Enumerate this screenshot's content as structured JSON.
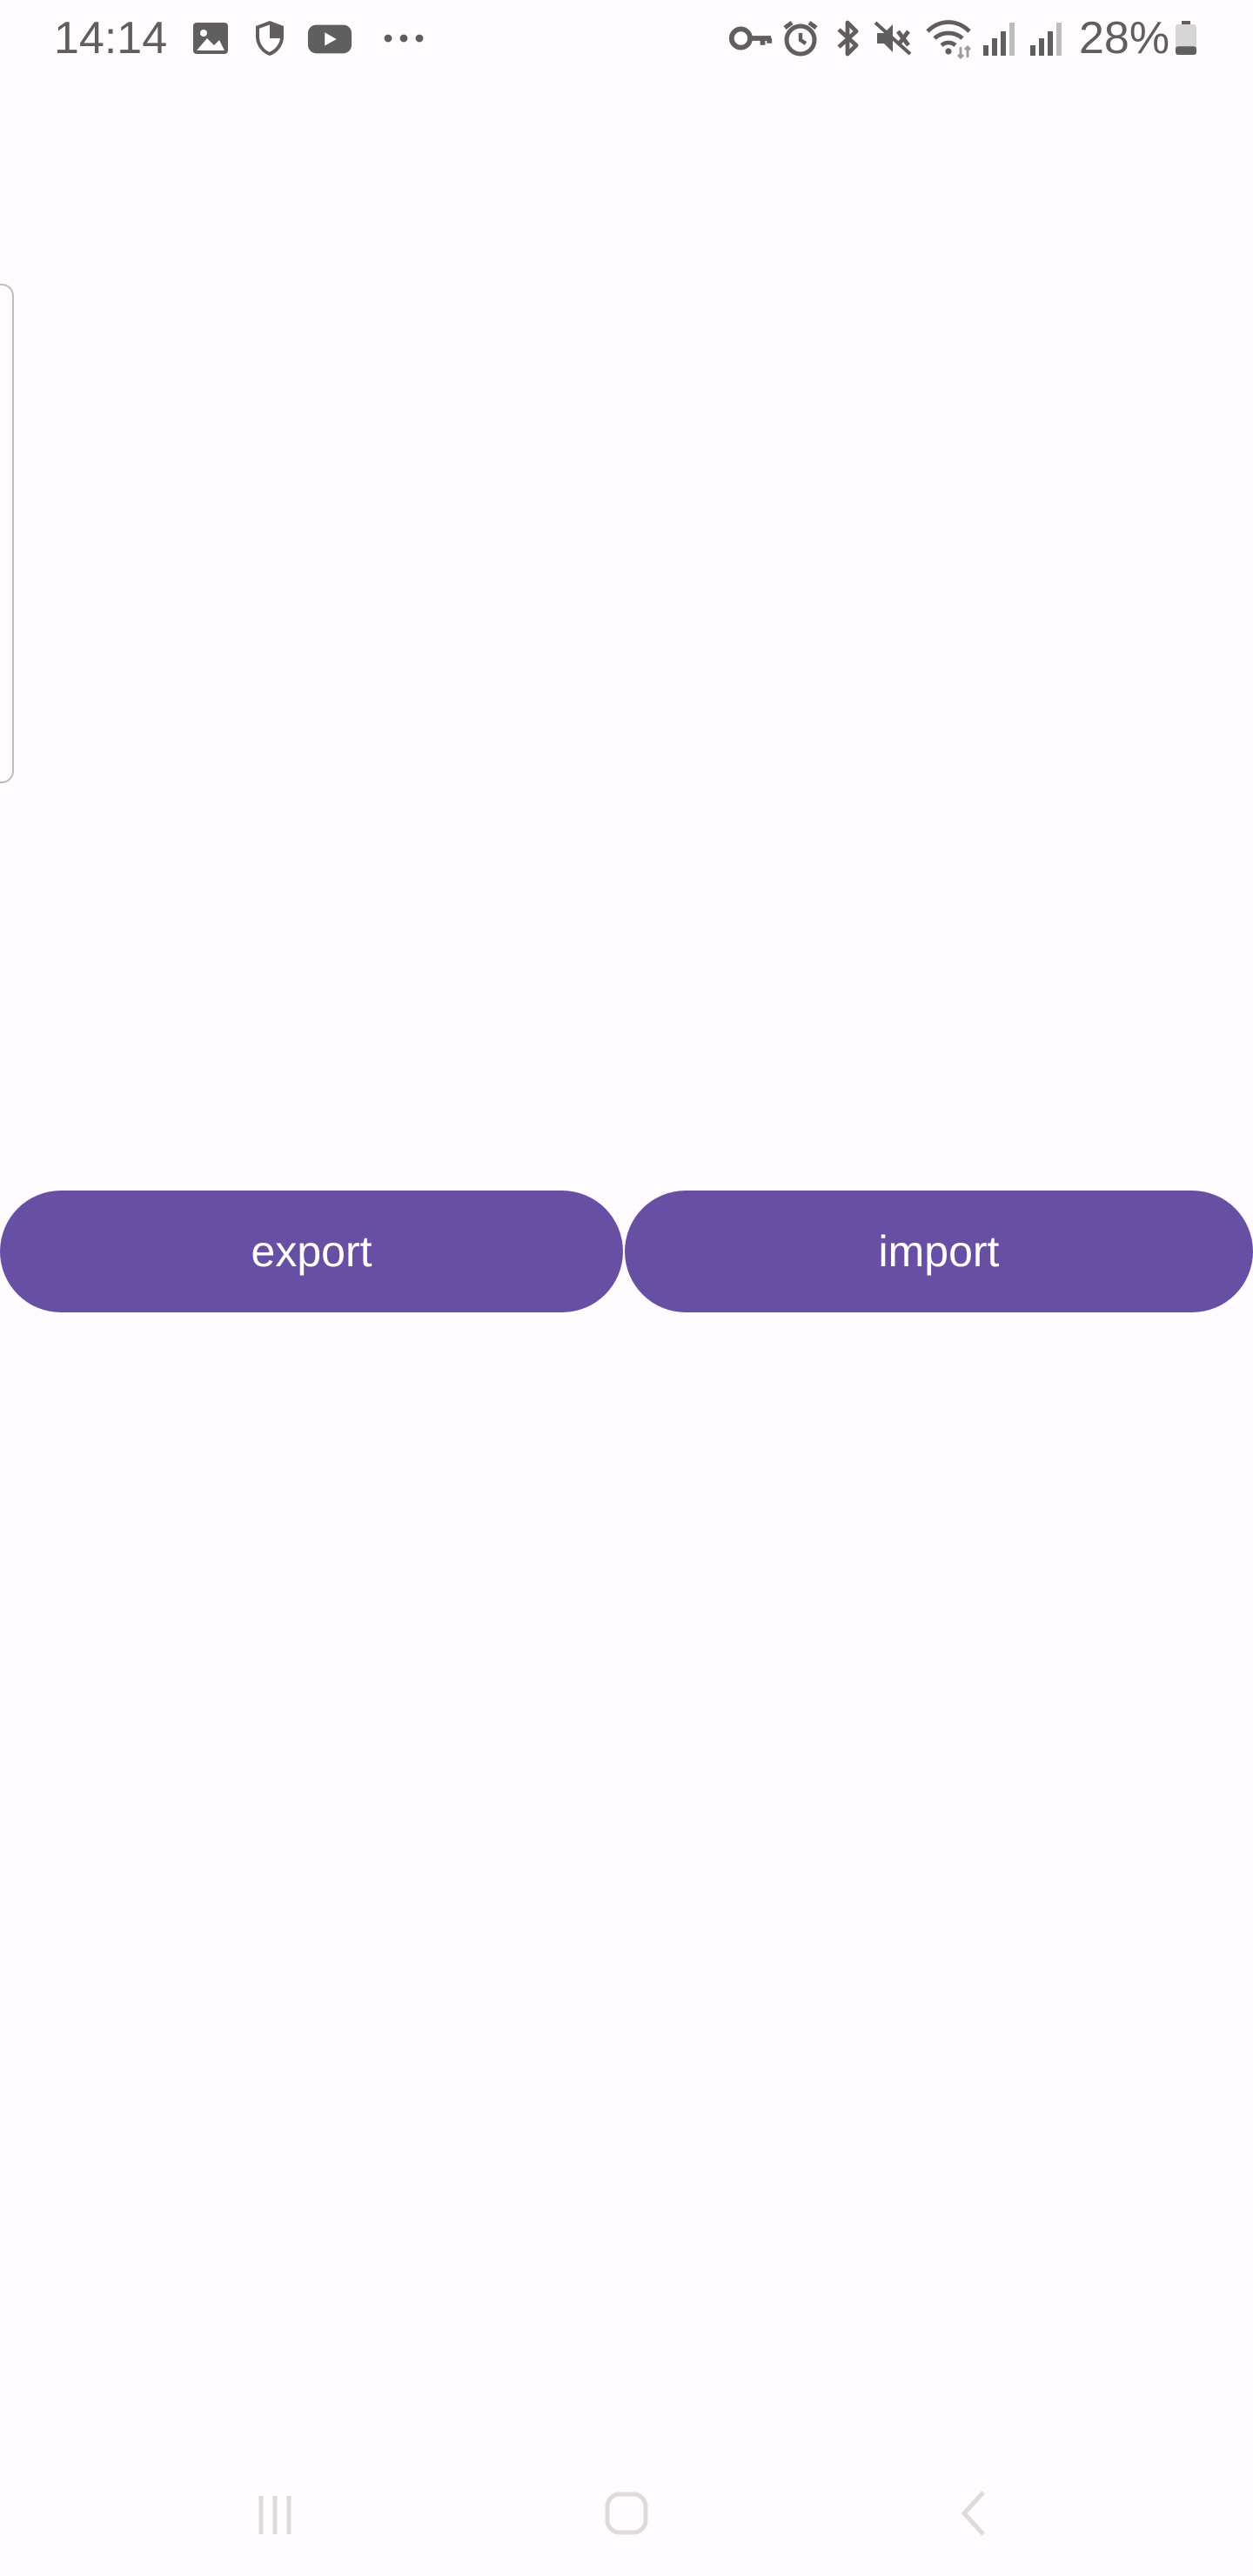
{
  "status_bar": {
    "time": "14:14",
    "battery_percent": "28%",
    "left_icons": [
      "gallery-icon",
      "shield-icon",
      "youtube-icon",
      "more-notifications-icon"
    ],
    "right_icons": [
      "vpn-key-icon",
      "alarm-icon",
      "bluetooth-icon",
      "mute-icon",
      "wifi-icon",
      "signal-icon",
      "signal-icon",
      "battery-icon"
    ],
    "battery_level": 0.28
  },
  "actions": {
    "export_label": "export",
    "import_label": "import"
  },
  "nav_bar": {
    "icons": [
      "recent-apps-icon",
      "home-icon",
      "back-icon"
    ]
  },
  "colors": {
    "background": "#fffbfe",
    "button": "#6750a4",
    "button_text": "#ffffff",
    "status_text": "#5f5f5f"
  }
}
